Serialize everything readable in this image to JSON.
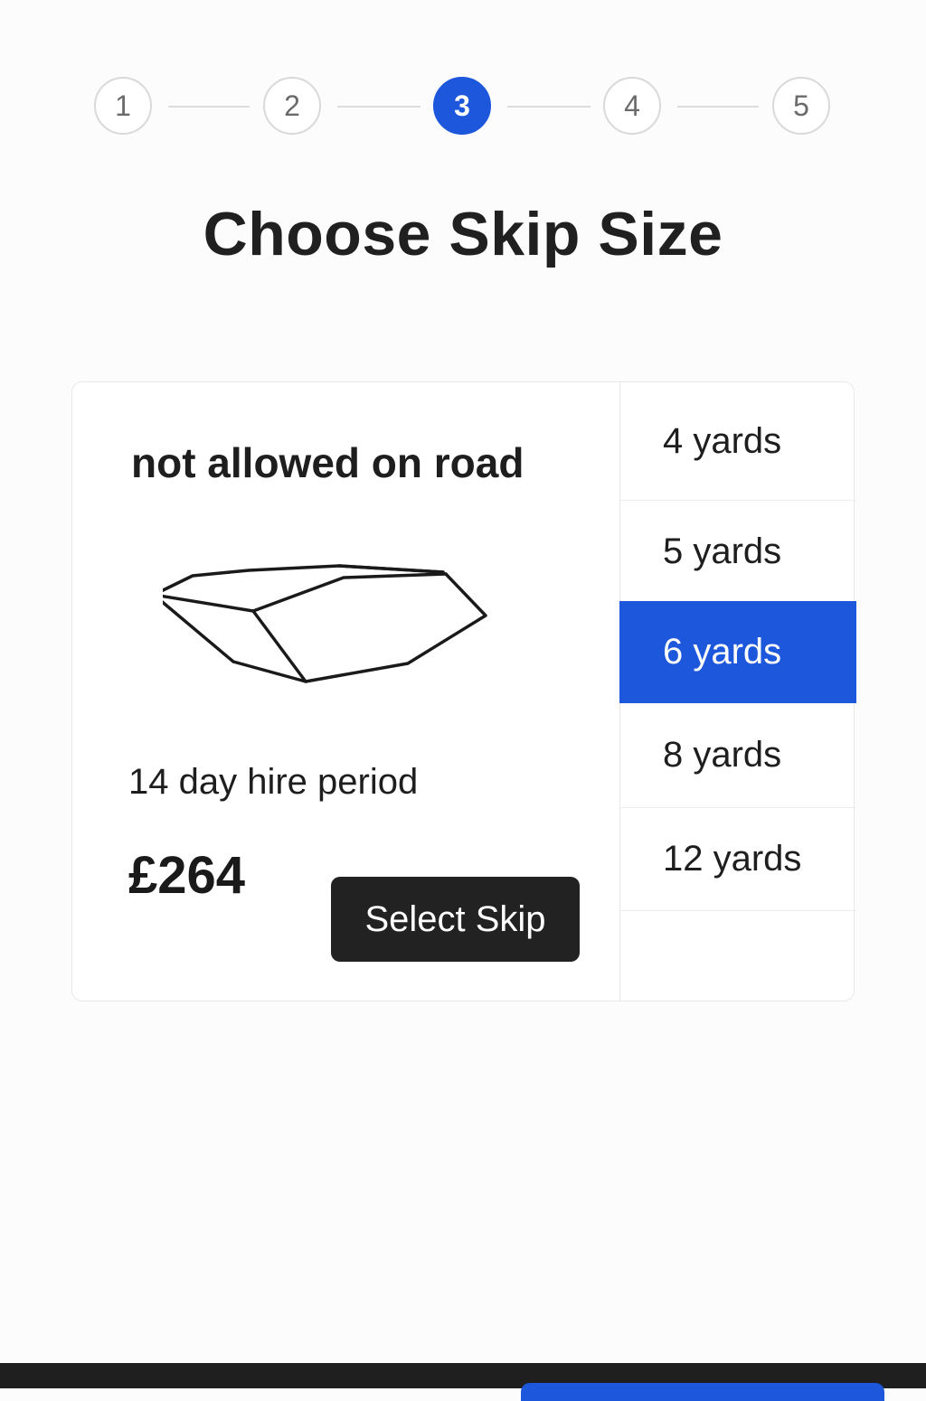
{
  "stepper": {
    "steps": [
      "1",
      "2",
      "3",
      "4",
      "5"
    ],
    "active_step": "3"
  },
  "page": {
    "title": "Choose Skip Size"
  },
  "card": {
    "road_note": "not allowed on road",
    "illustration_icon": "skip-container-icon",
    "hire_period": "14 day hire period",
    "price": "£264",
    "select_button_label": "Select Skip"
  },
  "sizes": {
    "options": [
      "4 yards",
      "5 yards",
      "6 yards",
      "8 yards",
      "12 yards"
    ],
    "selected": "6 yards"
  },
  "colors": {
    "accent": "#1c57dc",
    "dark_button": "#222222",
    "bottom_bar": "#1f1f1f"
  }
}
